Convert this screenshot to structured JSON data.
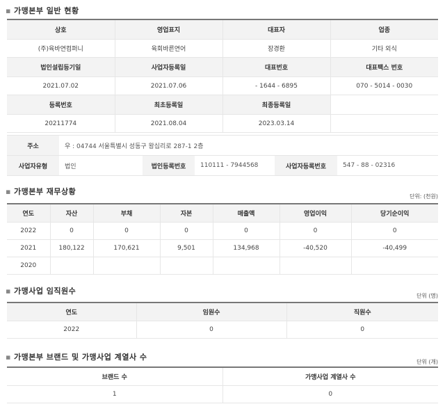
{
  "general": {
    "title": "가맹본부 일반 현황",
    "row1_headers": [
      "상호",
      "영업표지",
      "대표자",
      "업종"
    ],
    "row1_values": [
      "(주)육바연컴퍼니",
      "육회바른연어",
      "장경환",
      "기타 외식"
    ],
    "row2_headers": [
      "법인설립등기일",
      "사업자등록일",
      "대표번호",
      "대표팩스 번호"
    ],
    "row2_values": [
      "2021.07.02",
      "2021.07.06",
      "- 1644 - 6895",
      "070 - 5014 - 0030"
    ],
    "row3_headers": [
      "등록번호",
      "최초등록일",
      "최종등록일",
      ""
    ],
    "row3_values": [
      "20211774",
      "2021.08.04",
      "2023.03.14",
      ""
    ]
  },
  "details": {
    "address_label": "주소",
    "address_value": "우 : 04744 서울특별시 성동구 왕십리로 287-1 2층",
    "biz_type_label": "사업자유형",
    "biz_type_value": "법인",
    "corp_reg_label": "법인등록번호",
    "corp_reg_value": "110111 - 7944568",
    "biz_reg_label": "사업자등록번호",
    "biz_reg_value": "547 - 88 - 02316"
  },
  "finance": {
    "title": "가맹본부 재무상황",
    "unit": "단위: (천원)",
    "headers": [
      "연도",
      "자산",
      "부채",
      "자본",
      "매출액",
      "영업이익",
      "당기순이익"
    ],
    "rows": [
      [
        "2022",
        "0",
        "0",
        "0",
        "0",
        "0",
        "0"
      ],
      [
        "2021",
        "180,122",
        "170,621",
        "9,501",
        "134,968",
        "-40,520",
        "-40,499"
      ],
      [
        "2020",
        "",
        "",
        "",
        "",
        "",
        ""
      ]
    ]
  },
  "staff": {
    "title": "가맹사업 임직원수",
    "unit": "단위 (명)",
    "headers": [
      "연도",
      "임원수",
      "직원수"
    ],
    "rows": [
      [
        "2022",
        "0",
        "0"
      ]
    ]
  },
  "brands": {
    "title": "가맹본부 브랜드 및 가맹사업 계열사 수",
    "unit": "단위 (개)",
    "headers": [
      "브랜드 수",
      "가맹사업 계열사 수"
    ],
    "rows": [
      [
        "1",
        "0"
      ]
    ]
  }
}
